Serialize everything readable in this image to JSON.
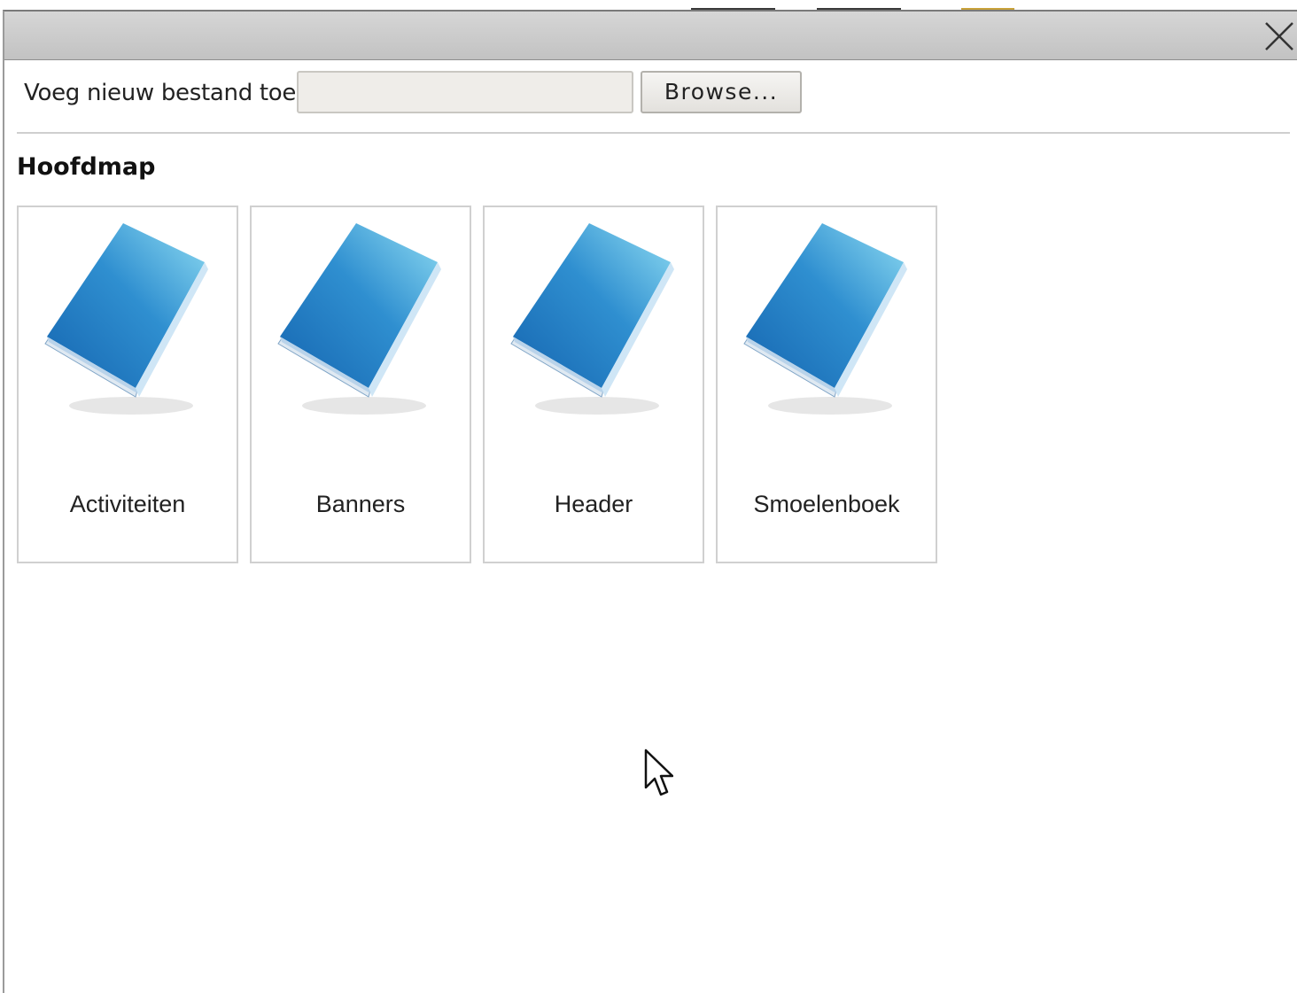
{
  "dialog": {
    "close_icon": "close-icon"
  },
  "upload": {
    "label": "Voeg nieuw bestand toe:",
    "file_value": "",
    "browse_label": "Browse..."
  },
  "folder": {
    "title": "Hoofdmap",
    "items": [
      {
        "label": "Activiteiten",
        "icon": "book-icon"
      },
      {
        "label": "Banners",
        "icon": "book-icon"
      },
      {
        "label": "Header",
        "icon": "book-icon"
      },
      {
        "label": "Smoelenboek",
        "icon": "book-icon"
      }
    ]
  },
  "colors": {
    "book_blue_dark": "#1a6fb8",
    "book_blue_light": "#7fd2ee",
    "titlebar": "#cacaca"
  }
}
